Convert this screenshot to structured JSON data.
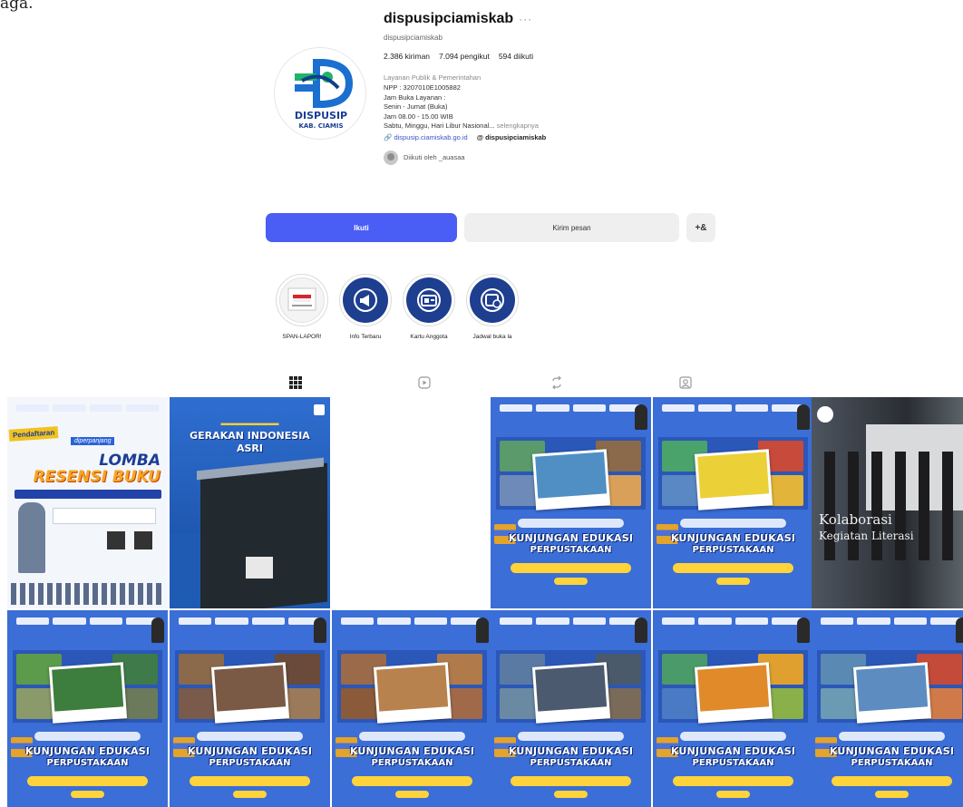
{
  "stray_text": "aga.",
  "profile": {
    "username": "dispusipciamiskab",
    "handle": "dispusipciamiskab",
    "stats": {
      "posts": "2.386 kiriman",
      "followers": "7.094 pengikut",
      "following": "594 diikuti"
    },
    "category": "Layanan Publik & Pemerintahan",
    "bio_lines": [
      "NPP : 3207010E1005882",
      "Jam Buka Layanan :",
      "Senin - Jumat (Buka)",
      "Jam 08.00 - 15.00 WIB",
      "Sabtu, Minggu, Hari Libur Nasional..."
    ],
    "bio_more": "selengkapnya",
    "link": "dispusip.ciamiskab.go.id",
    "threads": "dispusipciamiskab",
    "followed_by": "Diikuti oleh _auasaa",
    "logo_text": "DISPUSIP",
    "logo_subtext": "KAB. CIAMIS"
  },
  "buttons": {
    "follow": "Ikuti",
    "message": "Kirim pesan",
    "add": "+&"
  },
  "highlights": [
    {
      "label": "SPAN-LAPOR!",
      "icon": "document-flag-icon"
    },
    {
      "label": "Info Terbaru",
      "icon": "megaphone-icon"
    },
    {
      "label": "Kartu Anggota",
      "icon": "member-card-icon"
    },
    {
      "label": "Jadwal buka la",
      "icon": "calendar-clock-icon"
    }
  ],
  "tabs": [
    {
      "name": "posts",
      "icon": "grid-icon",
      "active": true
    },
    {
      "name": "reels",
      "icon": "reels-icon",
      "active": false
    },
    {
      "name": "reposts",
      "icon": "repost-icon",
      "active": false
    },
    {
      "name": "tagged",
      "icon": "tagged-icon",
      "active": false
    }
  ],
  "posts": {
    "lomba": {
      "pre": "Pendaftaran",
      "pre2": "diperpanjang",
      "title1": "LOMBA",
      "title2": "RESENSI BUKU"
    },
    "gerakan": {
      "title1": "GERAKAN INDONESIA",
      "title2": "ASRI"
    },
    "kunjungan": {
      "title1": "KUNJUNGAN EDUKASI",
      "title2": "PERPUSTAKAAN"
    },
    "kolaborasi": {
      "title1": "Kolaborasi",
      "title2": "Kegiatan Literasi"
    }
  },
  "colors": {
    "accent": "#4a5df5",
    "tile_blue": "#3b6ed6",
    "highlight_blue": "#1e3e8f",
    "ribbon_yellow": "#ffd33a"
  }
}
